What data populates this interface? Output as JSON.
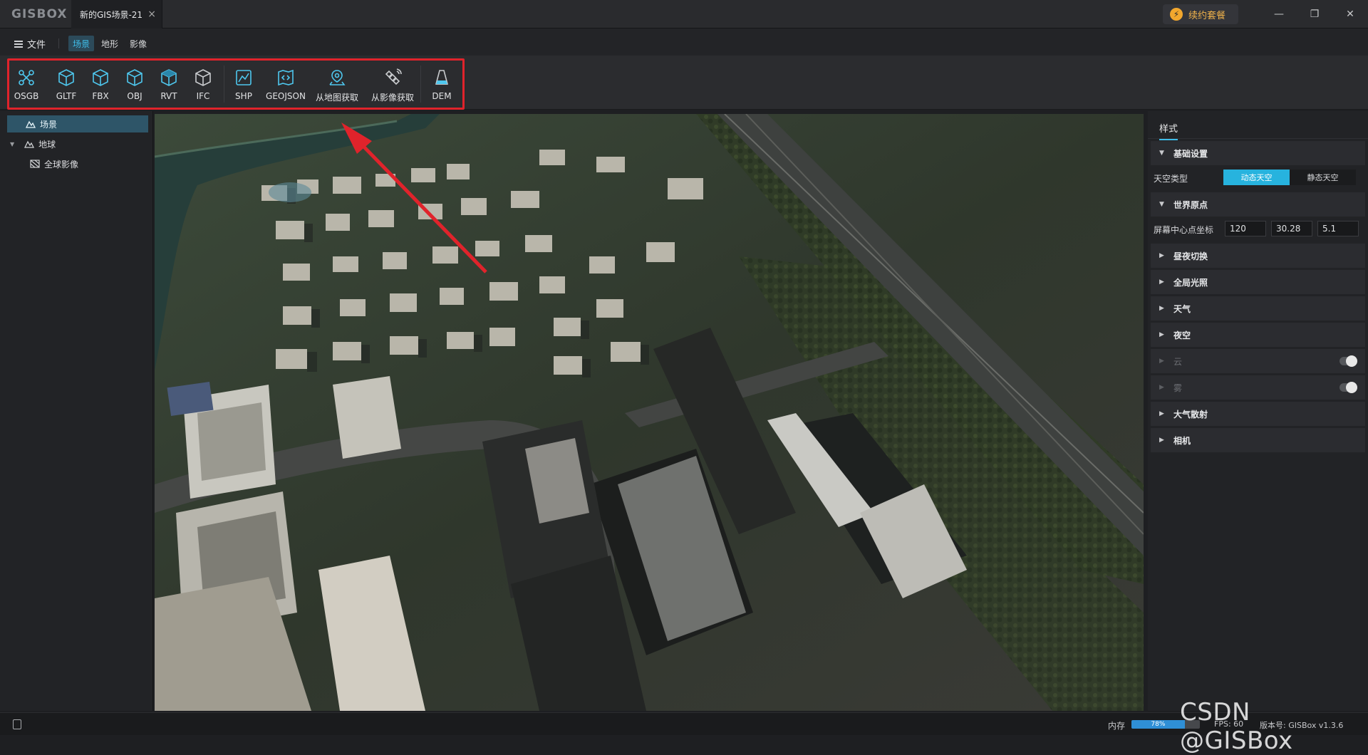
{
  "app": {
    "logo": "GISBOX"
  },
  "tab": {
    "title": "新的GIS场景-21",
    "close": "×"
  },
  "renew": {
    "label": "续约套餐",
    "icon": "lightning-icon"
  },
  "window": {
    "minimize": "—",
    "restore": "❐",
    "close": "✕"
  },
  "menu": {
    "file": "文件",
    "tabs": [
      {
        "label": "场景",
        "active": true
      },
      {
        "label": "地形",
        "active": false
      },
      {
        "label": "影像",
        "active": false
      }
    ]
  },
  "toolbar": {
    "items": [
      {
        "label": "OSGB",
        "icon": "osgb-icon"
      },
      {
        "label": "GLTF",
        "icon": "cube-icon"
      },
      {
        "label": "FBX",
        "icon": "cube-icon"
      },
      {
        "label": "OBJ",
        "icon": "cube-icon"
      },
      {
        "label": "RVT",
        "icon": "cube-icon"
      },
      {
        "label": "IFC",
        "icon": "cube-icon"
      },
      {
        "label": "SHP",
        "icon": "shp-icon"
      },
      {
        "label": "GEOJSON",
        "icon": "geojson-icon"
      },
      {
        "label": "从地图获取",
        "icon": "map-pin-icon"
      },
      {
        "label": "从影像获取",
        "icon": "satellite-icon"
      },
      {
        "label": "DEM",
        "icon": "dem-icon"
      }
    ]
  },
  "tree": {
    "scene": "场景",
    "earth": "地球",
    "global_imagery": "全球影像"
  },
  "right_panel": {
    "tab": "样式",
    "basic_settings": "基础设置",
    "sky_type_label": "天空类型",
    "sky_dynamic": "动态天空",
    "sky_static": "静态天空",
    "world_origin": "世界原点",
    "screen_center_label": "屏幕中心点坐标",
    "coord_x": "120",
    "coord_y": "30.28",
    "coord_z": "5.1",
    "sections": [
      {
        "label": "昼夜切换",
        "disabled": false
      },
      {
        "label": "全局光照",
        "disabled": false
      },
      {
        "label": "天气",
        "disabled": false
      },
      {
        "label": "夜空",
        "disabled": false
      },
      {
        "label": "云",
        "disabled": true
      },
      {
        "label": "雾",
        "disabled": true
      },
      {
        "label": "大气散射",
        "disabled": false
      },
      {
        "label": "相机",
        "disabled": false
      }
    ]
  },
  "status": {
    "memory_label": "内存",
    "memory_fraction": 0.78,
    "memory_text": "78%",
    "fps": "FPS: 60",
    "version": "版本号: GISBox v1.3.6"
  },
  "watermark": "CSDN @GISBox",
  "colors": {
    "accent": "#27b3de",
    "highlight": "#e0232b",
    "renew": "#f2a72d"
  }
}
